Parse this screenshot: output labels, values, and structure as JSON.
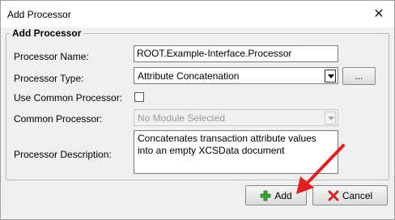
{
  "window": {
    "title": "Add Processor",
    "close_glyph": "✕"
  },
  "group": {
    "legend": "Add Processor"
  },
  "form": {
    "name_label": "Processor Name:",
    "name_value": "ROOT.Example-Interface.Processor",
    "type_label": "Processor Type:",
    "type_value": "Attribute Concatenation",
    "browse_label": "...",
    "use_common_label": "Use Common Processor:",
    "use_common_checked": false,
    "common_label": "Common Processor:",
    "common_value": "No Module Selected",
    "description_label": "Processor Description:",
    "description_value": "Concatenates transaction attribute values into an empty XCSData document"
  },
  "buttons": {
    "add_label": "Add",
    "cancel_label": "Cancel",
    "add_icon": "plus-icon",
    "cancel_icon": "red-x-icon"
  },
  "colors": {
    "annotation_arrow": "#e02020",
    "plus_green": "#3aa635",
    "cancel_red": "#d42020"
  }
}
